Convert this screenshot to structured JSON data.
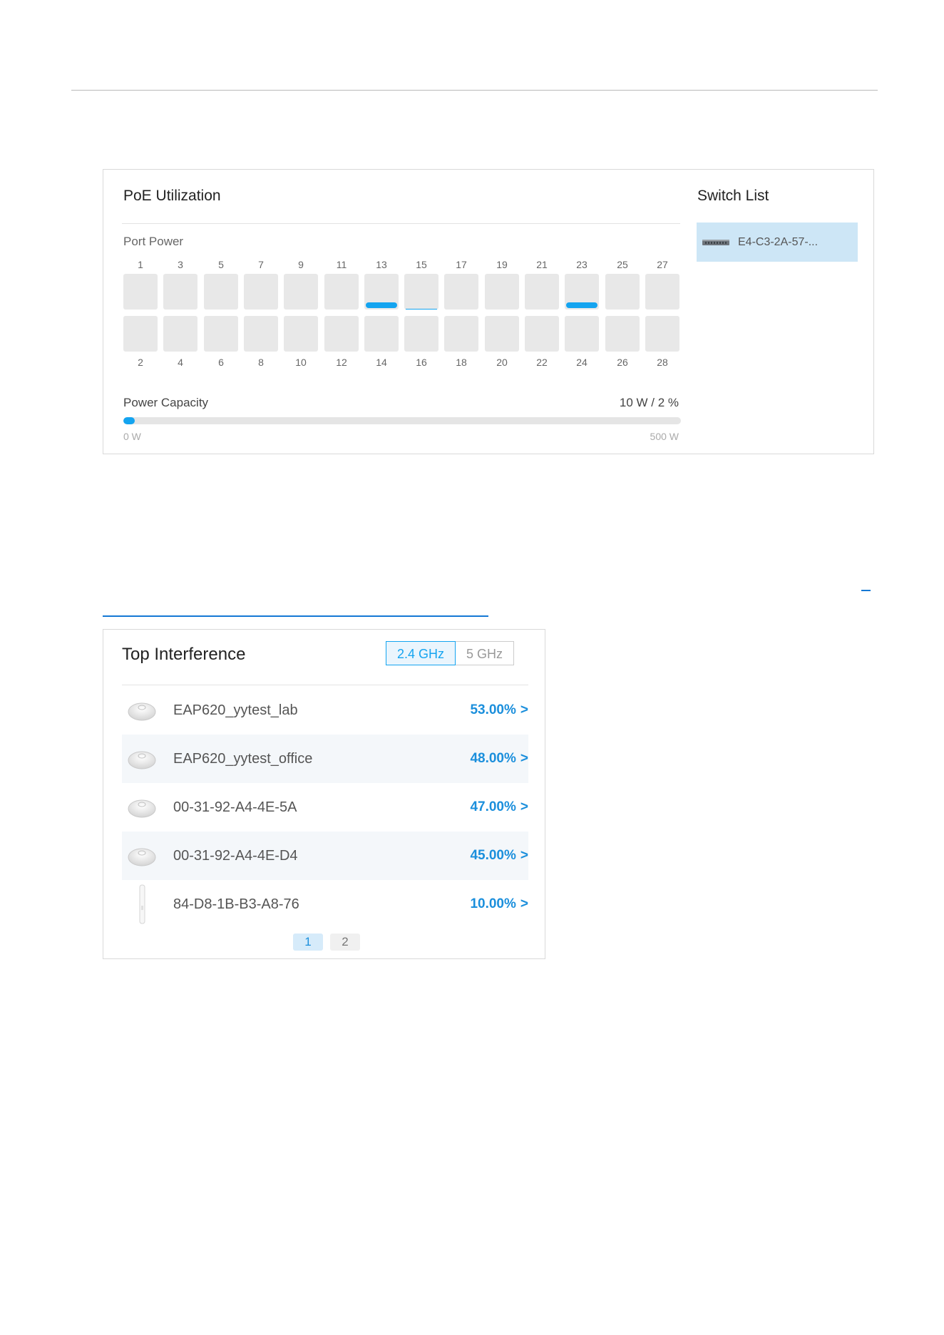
{
  "poe": {
    "title": "PoE Utilization",
    "port_power_label": "Port Power",
    "ports_top": [
      {
        "num": "1",
        "load": 0
      },
      {
        "num": "3",
        "load": 0
      },
      {
        "num": "5",
        "load": 0
      },
      {
        "num": "7",
        "load": 0
      },
      {
        "num": "9",
        "load": 0
      },
      {
        "num": "11",
        "load": 0
      },
      {
        "num": "13",
        "load": 0.15
      },
      {
        "num": "15",
        "load": 0.02
      },
      {
        "num": "17",
        "load": 0
      },
      {
        "num": "19",
        "load": 0
      },
      {
        "num": "21",
        "load": 0
      },
      {
        "num": "23",
        "load": 0.15
      },
      {
        "num": "25",
        "load": 0
      },
      {
        "num": "27",
        "load": 0
      }
    ],
    "ports_bottom": [
      {
        "num": "2",
        "load": 0
      },
      {
        "num": "4",
        "load": 0
      },
      {
        "num": "6",
        "load": 0
      },
      {
        "num": "8",
        "load": 0
      },
      {
        "num": "10",
        "load": 0
      },
      {
        "num": "12",
        "load": 0
      },
      {
        "num": "14",
        "load": 0
      },
      {
        "num": "16",
        "load": 0
      },
      {
        "num": "18",
        "load": 0
      },
      {
        "num": "20",
        "load": 0
      },
      {
        "num": "22",
        "load": 0
      },
      {
        "num": "24",
        "load": 0
      },
      {
        "num": "26",
        "load": 0
      },
      {
        "num": "28",
        "load": 0
      }
    ],
    "capacity": {
      "label": "Power Capacity",
      "value_text": "10 W / 2 %",
      "percent": 2,
      "min_label": "0 W",
      "max_label": "500 W"
    },
    "accent_color": "#14a4f0"
  },
  "switch_list": {
    "title": "Switch List",
    "items": [
      {
        "label": "E4-C3-2A-57-...",
        "icon": "switch-device-icon"
      }
    ]
  },
  "top_interference": {
    "title": "Top Interference",
    "bands": [
      {
        "label": "2.4 GHz",
        "active": true
      },
      {
        "label": "5 GHz",
        "active": false
      }
    ],
    "rows": [
      {
        "name": "EAP620_yytest_lab",
        "value": "53.00%",
        "arrow": ">",
        "icon": "ceiling-ap-icon"
      },
      {
        "name": "EAP620_yytest_office",
        "value": "48.00%",
        "arrow": ">",
        "icon": "ceiling-ap-icon"
      },
      {
        "name": "00-31-92-A4-4E-5A",
        "value": "47.00%",
        "arrow": ">",
        "icon": "ceiling-ap-icon"
      },
      {
        "name": "00-31-92-A4-4E-D4",
        "value": "45.00%",
        "arrow": ">",
        "icon": "ceiling-ap-icon"
      },
      {
        "name": "84-D8-1B-B3-A8-76",
        "value": "10.00%",
        "arrow": ">",
        "icon": "outdoor-ap-icon"
      }
    ],
    "pages": [
      {
        "label": "1",
        "active": true
      },
      {
        "label": "2",
        "active": false
      }
    ],
    "value_color": "#1b8fdc"
  }
}
